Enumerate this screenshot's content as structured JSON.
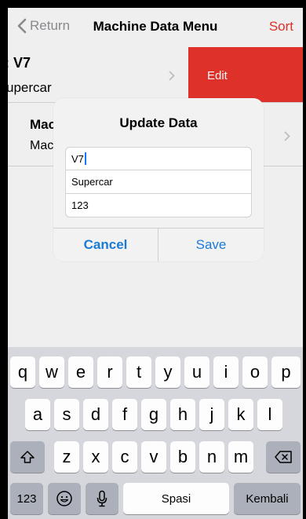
{
  "nav": {
    "back_label": "Return",
    "title": "Machine Data Menu",
    "sort_label": "Sort"
  },
  "list": {
    "row1": {
      "title": ": V7",
      "subtitle": "upercar",
      "action_label": "Edit"
    },
    "row2": {
      "title": "Mac",
      "subtitle": "Mac"
    }
  },
  "alert": {
    "title": "Update Data",
    "fields": {
      "name": "V7",
      "type": "Supercar",
      "number": "123"
    },
    "cancel_label": "Cancel",
    "save_label": "Save"
  },
  "keyboard": {
    "row1": [
      "q",
      "w",
      "e",
      "r",
      "t",
      "y",
      "u",
      "i",
      "o",
      "p"
    ],
    "row2": [
      "a",
      "s",
      "d",
      "f",
      "g",
      "h",
      "j",
      "k",
      "l"
    ],
    "row3": [
      "z",
      "x",
      "c",
      "v",
      "b",
      "n",
      "m"
    ],
    "numbers_label": "123",
    "space_label": "Spasi",
    "return_label": "Kembali"
  },
  "colors": {
    "accent_red": "#e5332b",
    "button_blue": "#1a7bd6",
    "caret_blue": "#1877f2"
  },
  "icons": [
    "chevron-left-icon",
    "chevron-right-icon",
    "shift-icon",
    "delete-icon",
    "emoji-icon",
    "mic-icon"
  ]
}
